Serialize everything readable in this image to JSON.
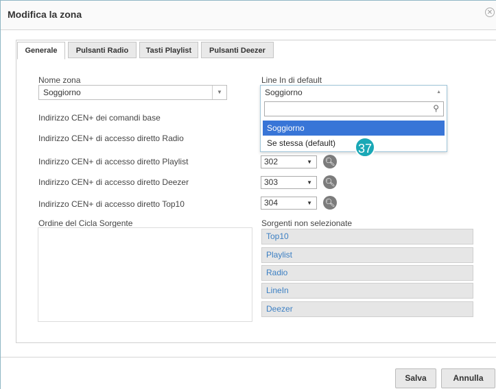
{
  "dialog": {
    "title": "Modifica la zona"
  },
  "tabs": [
    {
      "label": "Generale"
    },
    {
      "label": "Pulsanti Radio"
    },
    {
      "label": "Tasti Playlist"
    },
    {
      "label": "Pulsanti Deezer"
    }
  ],
  "form": {
    "zone_name_label": "Nome zona",
    "zone_name_value": "Soggiorno",
    "line_in_label": "Line In di default",
    "line_in_value": "Soggiorno",
    "line_in_search_placeholder": "",
    "line_in_options": [
      "Soggiorno",
      "Se stessa (default)"
    ],
    "cen_base_label": "Indirizzo CEN+ dei comandi base",
    "cen_radio_label": "Indirizzo CEN+ di accesso diretto Radio",
    "cen_playlist_label": "Indirizzo CEN+ di accesso diretto Playlist",
    "cen_playlist_value": "302",
    "cen_deezer_label": "Indirizzo CEN+ di accesso diretto Deezer",
    "cen_deezer_value": "303",
    "cen_top10_label": "Indirizzo CEN+ di accesso diretto Top10",
    "cen_top10_value": "304",
    "cycle_label": "Ordine del Cicla Sorgente",
    "unselected_label": "Sorgenti non selezionate",
    "unselected_sources": [
      "Top10",
      "Playlist",
      "Radio",
      "LineIn",
      "Deezer"
    ]
  },
  "annotation": {
    "badge": "37"
  },
  "footer": {
    "save_label": "Salva",
    "cancel_label": "Annulla"
  },
  "icons": {
    "close": "close-icon",
    "search": "search-icon",
    "dropdown": "chevron-down-icon"
  },
  "colors": {
    "selected_option": "#3875d7",
    "badge": "#1aa8b6",
    "source_text": "#3b7fc3"
  }
}
